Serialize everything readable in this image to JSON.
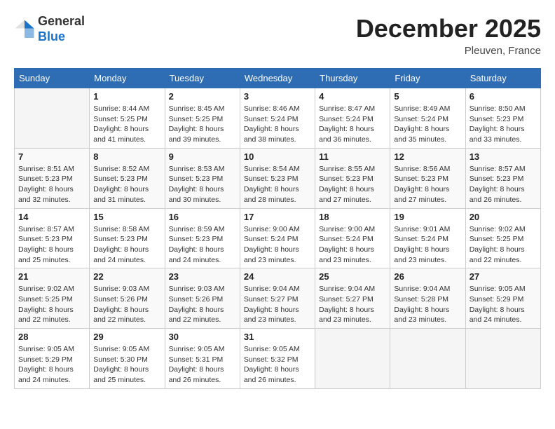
{
  "header": {
    "logo_line1": "General",
    "logo_line2": "Blue",
    "month": "December 2025",
    "location": "Pleuven, France"
  },
  "weekdays": [
    "Sunday",
    "Monday",
    "Tuesday",
    "Wednesday",
    "Thursday",
    "Friday",
    "Saturday"
  ],
  "weeks": [
    [
      {
        "day": "",
        "sunrise": "",
        "sunset": "",
        "daylight": ""
      },
      {
        "day": "1",
        "sunrise": "Sunrise: 8:44 AM",
        "sunset": "Sunset: 5:25 PM",
        "daylight": "Daylight: 8 hours and 41 minutes."
      },
      {
        "day": "2",
        "sunrise": "Sunrise: 8:45 AM",
        "sunset": "Sunset: 5:25 PM",
        "daylight": "Daylight: 8 hours and 39 minutes."
      },
      {
        "day": "3",
        "sunrise": "Sunrise: 8:46 AM",
        "sunset": "Sunset: 5:24 PM",
        "daylight": "Daylight: 8 hours and 38 minutes."
      },
      {
        "day": "4",
        "sunrise": "Sunrise: 8:47 AM",
        "sunset": "Sunset: 5:24 PM",
        "daylight": "Daylight: 8 hours and 36 minutes."
      },
      {
        "day": "5",
        "sunrise": "Sunrise: 8:49 AM",
        "sunset": "Sunset: 5:24 PM",
        "daylight": "Daylight: 8 hours and 35 minutes."
      },
      {
        "day": "6",
        "sunrise": "Sunrise: 8:50 AM",
        "sunset": "Sunset: 5:23 PM",
        "daylight": "Daylight: 8 hours and 33 minutes."
      }
    ],
    [
      {
        "day": "7",
        "sunrise": "Sunrise: 8:51 AM",
        "sunset": "Sunset: 5:23 PM",
        "daylight": "Daylight: 8 hours and 32 minutes."
      },
      {
        "day": "8",
        "sunrise": "Sunrise: 8:52 AM",
        "sunset": "Sunset: 5:23 PM",
        "daylight": "Daylight: 8 hours and 31 minutes."
      },
      {
        "day": "9",
        "sunrise": "Sunrise: 8:53 AM",
        "sunset": "Sunset: 5:23 PM",
        "daylight": "Daylight: 8 hours and 30 minutes."
      },
      {
        "day": "10",
        "sunrise": "Sunrise: 8:54 AM",
        "sunset": "Sunset: 5:23 PM",
        "daylight": "Daylight: 8 hours and 28 minutes."
      },
      {
        "day": "11",
        "sunrise": "Sunrise: 8:55 AM",
        "sunset": "Sunset: 5:23 PM",
        "daylight": "Daylight: 8 hours and 27 minutes."
      },
      {
        "day": "12",
        "sunrise": "Sunrise: 8:56 AM",
        "sunset": "Sunset: 5:23 PM",
        "daylight": "Daylight: 8 hours and 27 minutes."
      },
      {
        "day": "13",
        "sunrise": "Sunrise: 8:57 AM",
        "sunset": "Sunset: 5:23 PM",
        "daylight": "Daylight: 8 hours and 26 minutes."
      }
    ],
    [
      {
        "day": "14",
        "sunrise": "Sunrise: 8:57 AM",
        "sunset": "Sunset: 5:23 PM",
        "daylight": "Daylight: 8 hours and 25 minutes."
      },
      {
        "day": "15",
        "sunrise": "Sunrise: 8:58 AM",
        "sunset": "Sunset: 5:23 PM",
        "daylight": "Daylight: 8 hours and 24 minutes."
      },
      {
        "day": "16",
        "sunrise": "Sunrise: 8:59 AM",
        "sunset": "Sunset: 5:23 PM",
        "daylight": "Daylight: 8 hours and 24 minutes."
      },
      {
        "day": "17",
        "sunrise": "Sunrise: 9:00 AM",
        "sunset": "Sunset: 5:24 PM",
        "daylight": "Daylight: 8 hours and 23 minutes."
      },
      {
        "day": "18",
        "sunrise": "Sunrise: 9:00 AM",
        "sunset": "Sunset: 5:24 PM",
        "daylight": "Daylight: 8 hours and 23 minutes."
      },
      {
        "day": "19",
        "sunrise": "Sunrise: 9:01 AM",
        "sunset": "Sunset: 5:24 PM",
        "daylight": "Daylight: 8 hours and 23 minutes."
      },
      {
        "day": "20",
        "sunrise": "Sunrise: 9:02 AM",
        "sunset": "Sunset: 5:25 PM",
        "daylight": "Daylight: 8 hours and 22 minutes."
      }
    ],
    [
      {
        "day": "21",
        "sunrise": "Sunrise: 9:02 AM",
        "sunset": "Sunset: 5:25 PM",
        "daylight": "Daylight: 8 hours and 22 minutes."
      },
      {
        "day": "22",
        "sunrise": "Sunrise: 9:03 AM",
        "sunset": "Sunset: 5:26 PM",
        "daylight": "Daylight: 8 hours and 22 minutes."
      },
      {
        "day": "23",
        "sunrise": "Sunrise: 9:03 AM",
        "sunset": "Sunset: 5:26 PM",
        "daylight": "Daylight: 8 hours and 22 minutes."
      },
      {
        "day": "24",
        "sunrise": "Sunrise: 9:04 AM",
        "sunset": "Sunset: 5:27 PM",
        "daylight": "Daylight: 8 hours and 23 minutes."
      },
      {
        "day": "25",
        "sunrise": "Sunrise: 9:04 AM",
        "sunset": "Sunset: 5:27 PM",
        "daylight": "Daylight: 8 hours and 23 minutes."
      },
      {
        "day": "26",
        "sunrise": "Sunrise: 9:04 AM",
        "sunset": "Sunset: 5:28 PM",
        "daylight": "Daylight: 8 hours and 23 minutes."
      },
      {
        "day": "27",
        "sunrise": "Sunrise: 9:05 AM",
        "sunset": "Sunset: 5:29 PM",
        "daylight": "Daylight: 8 hours and 24 minutes."
      }
    ],
    [
      {
        "day": "28",
        "sunrise": "Sunrise: 9:05 AM",
        "sunset": "Sunset: 5:29 PM",
        "daylight": "Daylight: 8 hours and 24 minutes."
      },
      {
        "day": "29",
        "sunrise": "Sunrise: 9:05 AM",
        "sunset": "Sunset: 5:30 PM",
        "daylight": "Daylight: 8 hours and 25 minutes."
      },
      {
        "day": "30",
        "sunrise": "Sunrise: 9:05 AM",
        "sunset": "Sunset: 5:31 PM",
        "daylight": "Daylight: 8 hours and 26 minutes."
      },
      {
        "day": "31",
        "sunrise": "Sunrise: 9:05 AM",
        "sunset": "Sunset: 5:32 PM",
        "daylight": "Daylight: 8 hours and 26 minutes."
      },
      {
        "day": "",
        "sunrise": "",
        "sunset": "",
        "daylight": ""
      },
      {
        "day": "",
        "sunrise": "",
        "sunset": "",
        "daylight": ""
      },
      {
        "day": "",
        "sunrise": "",
        "sunset": "",
        "daylight": ""
      }
    ]
  ]
}
